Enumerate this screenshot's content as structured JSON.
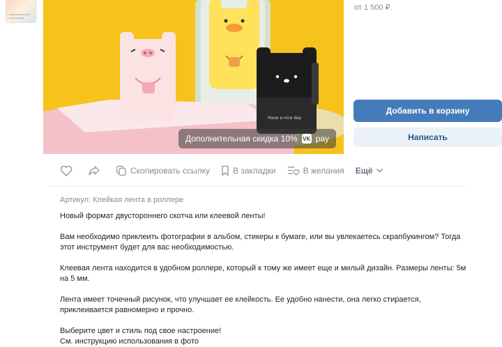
{
  "product": {
    "price_from": "от 1 500 ₽.",
    "discount_label": "Дополнительная скидка 10%",
    "pay_logo_text": "VK",
    "pay_label": "pay",
    "photo_caption": "Have a nice day"
  },
  "buttons": {
    "add_to_cart": "Добавить в корзину",
    "write": "Написать"
  },
  "actions": {
    "copy_link": "Скопировать ссылку",
    "bookmarks": "В закладки",
    "wishlist": "В желания",
    "more": "Ещё"
  },
  "description": {
    "article": "Артикул: Клейкая лента в роллере",
    "paragraphs": [
      "Новый формат двустороннего скотча или клеевой ленты!",
      "Вам необходимо приклеить фотографии в альбом, стикеры к бумаге, или вы увлекаетесь скрапбукингом? Тогда этот инструмент будет для вас необходимостью.",
      "Клеевая лента находится в удобном роллере, который к тому же имеет еще и милый дизайн. Размеры ленты: 5м на 5 мм.",
      "Лента имеет точечный рисунок, что улучшает ее клейкость. Ее удобно нанести, она легко стирается, приклеивается равномерно и прочно.",
      "Выберите цвет и стиль под свое настроение!",
      "См. инструкцию использования в фото"
    ]
  },
  "colors": {
    "accent": "#447bba",
    "secondary_button": "#ebf1f8",
    "secondary_text": "#2a5885",
    "muted": "#818c99",
    "photo_bg": "#f5c31b"
  }
}
